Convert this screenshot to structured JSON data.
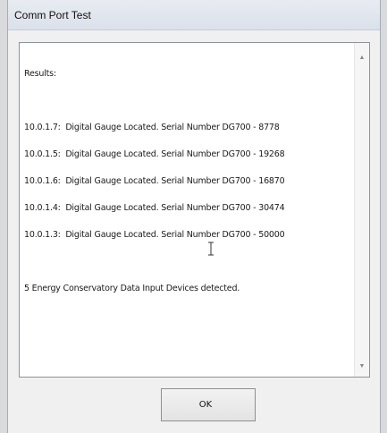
{
  "window": {
    "title": "Comm Port Test"
  },
  "results": {
    "header": "Results:",
    "lines": [
      "10.0.1.7:  Digital Gauge Located. Serial Number DG700 - 8778",
      "10.0.1.5:  Digital Gauge Located. Serial Number DG700 - 19268",
      "10.0.1.6:  Digital Gauge Located. Serial Number DG700 - 16870",
      "10.0.1.4:  Digital Gauge Located. Serial Number DG700 - 30474",
      "10.0.1.3:  Digital Gauge Located. Serial Number DG700 - 50000"
    ],
    "summary": "5 Energy Conservatory Data Input Devices detected."
  },
  "buttons": {
    "ok_label": "OK"
  },
  "icons": {
    "scroll_up": "scroll-up-arrow-icon",
    "scroll_down": "scroll-down-arrow-icon",
    "cursor": "text-ibeam-cursor-icon"
  }
}
